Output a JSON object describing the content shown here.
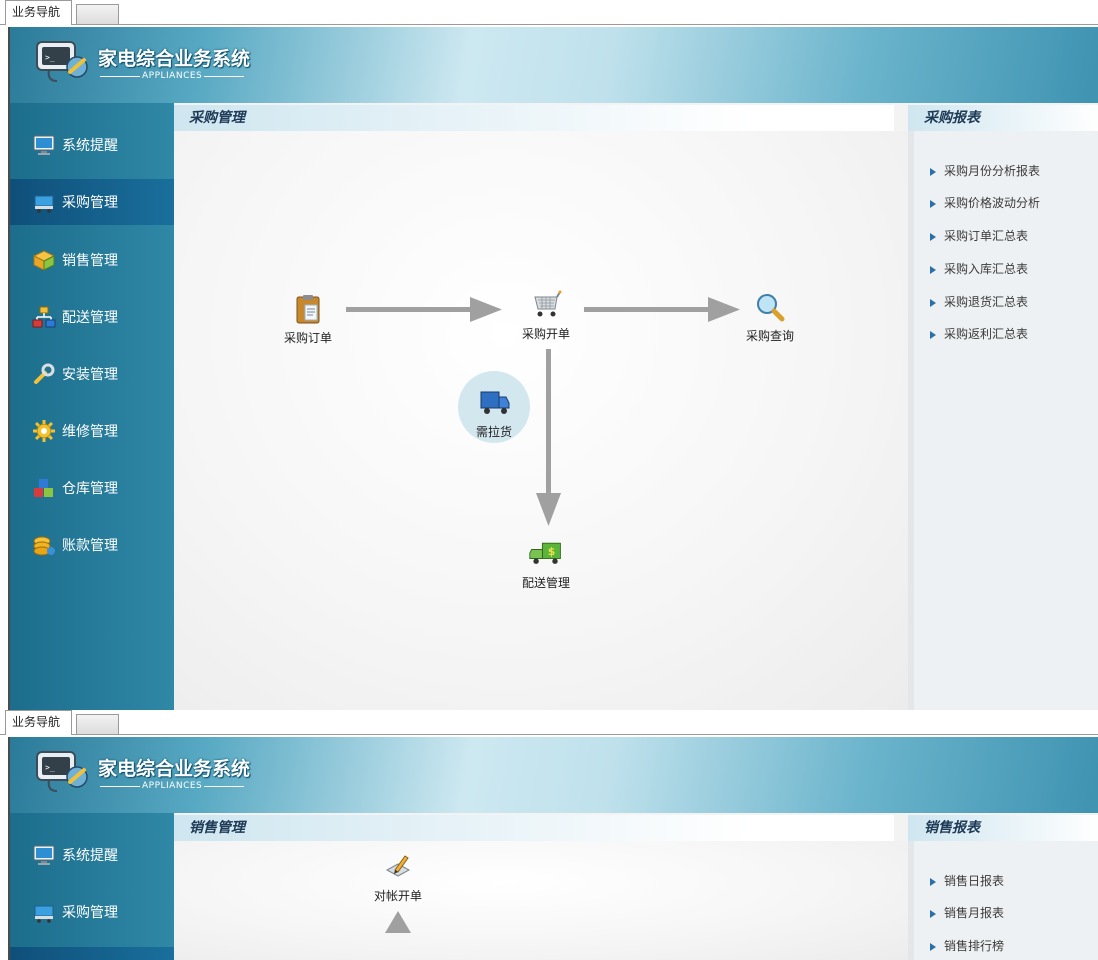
{
  "panel_purchase": {
    "tabs": [
      "业务导航",
      ""
    ],
    "app": {
      "title": "家电综合业务系统",
      "subtitle": "APPLIANCES"
    },
    "sidebar": [
      {
        "label": "系统提醒",
        "icon": "monitor-icon",
        "active": false
      },
      {
        "label": "采购管理",
        "icon": "cart-icon",
        "active": true
      },
      {
        "label": "销售管理",
        "icon": "box-icon",
        "active": false
      },
      {
        "label": "配送管理",
        "icon": "network-icon",
        "active": false
      },
      {
        "label": "安装管理",
        "icon": "wrench-icon",
        "active": false
      },
      {
        "label": "维修管理",
        "icon": "gear-icon",
        "active": false
      },
      {
        "label": "仓库管理",
        "icon": "blocks-icon",
        "active": false
      },
      {
        "label": "账款管理",
        "icon": "coins-icon",
        "active": false
      }
    ],
    "section_title": "采购管理",
    "report_title": "采购报表",
    "flow_nodes": [
      "采购订单",
      "采购开单",
      "采购查询",
      "需拉货",
      "配送管理"
    ],
    "reports": [
      "采购月份分析报表",
      "采购价格波动分析",
      "采购订单汇总表",
      "采购入库汇总表",
      "采购退货汇总表",
      "采购返利汇总表"
    ]
  },
  "panel_sales": {
    "tabs": [
      "业务导航",
      ""
    ],
    "app": {
      "title": "家电综合业务系统",
      "subtitle": "APPLIANCES"
    },
    "sidebar": [
      {
        "label": "系统提醒",
        "icon": "monitor-icon",
        "active": false
      },
      {
        "label": "采购管理",
        "icon": "cart-icon",
        "active": false
      }
    ],
    "section_title": "销售管理",
    "report_title": "销售报表",
    "flow_nodes": [
      "对帐开单"
    ],
    "reports": [
      "销售日报表",
      "销售月报表",
      "销售排行榜"
    ]
  },
  "colors": {
    "sidebar": "#2a7f9f",
    "sidebar_active": "#145c89",
    "accent": "#2b6fa6",
    "circle": "#d3e7ef",
    "arrow": "#9e9e9e"
  }
}
